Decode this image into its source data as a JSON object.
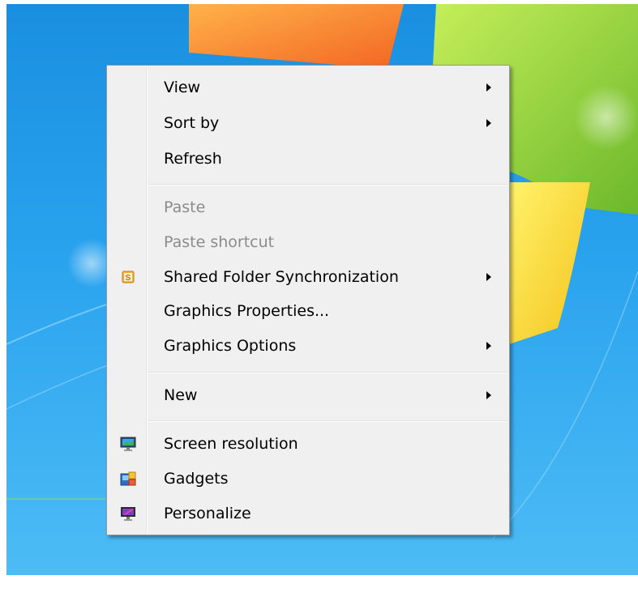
{
  "menu": {
    "items": [
      {
        "label": "View",
        "submenu": true,
        "enabled": true
      },
      {
        "label": "Sort by",
        "submenu": true,
        "enabled": true
      },
      {
        "label": "Refresh",
        "submenu": false,
        "enabled": true
      },
      {
        "label": "Paste",
        "submenu": false,
        "enabled": false
      },
      {
        "label": "Paste shortcut",
        "submenu": false,
        "enabled": false
      },
      {
        "label": "Shared Folder Synchronization",
        "submenu": true,
        "enabled": true,
        "icon": "shared-folder-sync-icon"
      },
      {
        "label": "Graphics Properties...",
        "submenu": false,
        "enabled": true
      },
      {
        "label": "Graphics Options",
        "submenu": true,
        "enabled": true
      },
      {
        "label": "New",
        "submenu": true,
        "enabled": true
      },
      {
        "label": "Screen resolution",
        "submenu": false,
        "enabled": true,
        "icon": "screen-resolution-icon"
      },
      {
        "label": "Gadgets",
        "submenu": false,
        "enabled": true,
        "icon": "gadgets-icon"
      },
      {
        "label": "Personalize",
        "submenu": false,
        "enabled": true,
        "icon": "personalize-icon"
      }
    ]
  },
  "colors": {
    "desktop_blue": "#2aa3ee",
    "menu_background": "#f0f0f0",
    "disabled_text": "#8b8b8b"
  }
}
